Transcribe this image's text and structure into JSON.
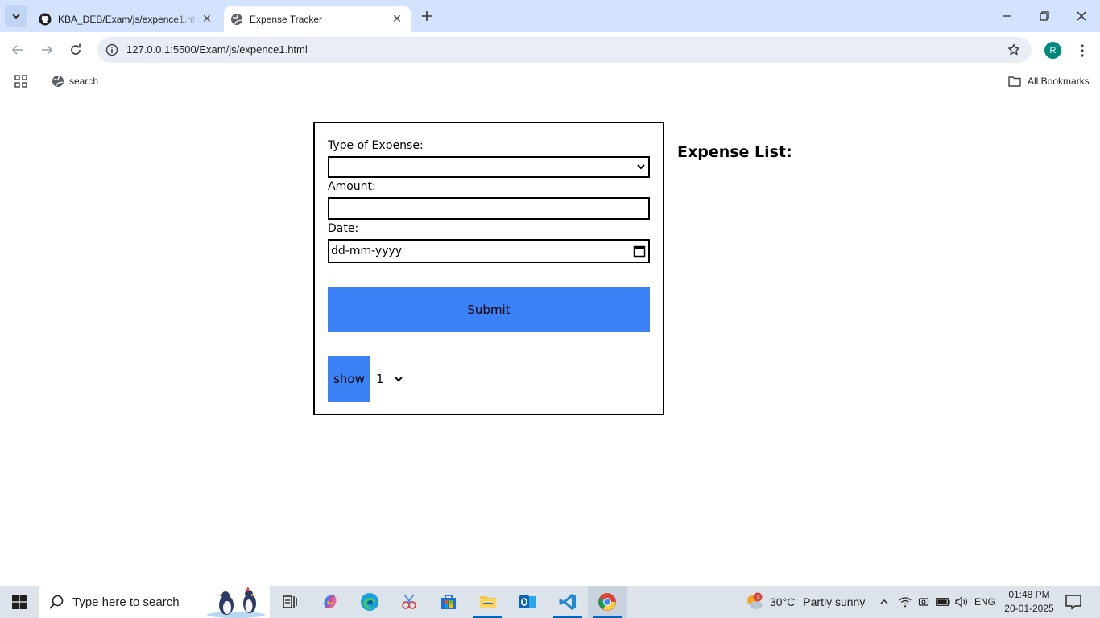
{
  "browser": {
    "tabs": [
      {
        "title": "KBA_DEB/Exam/js/expence1.html",
        "icon": "github-icon",
        "active": false
      },
      {
        "title": "Expense Tracker",
        "icon": "globe-icon",
        "active": true
      }
    ],
    "url": "127.0.0.1:5500/Exam/js/expence1.html",
    "profile_initial": "R",
    "bookmarks": [
      {
        "label": "search",
        "icon": "globe-icon"
      }
    ],
    "all_bookmarks_label": "All Bookmarks"
  },
  "page": {
    "form": {
      "type_label": "Type of Expense:",
      "type_value": "",
      "amount_label": "Amount:",
      "amount_value": "",
      "date_label": "Date:",
      "date_placeholder": "dd-mm-yyyy",
      "submit_label": "Submit",
      "show_label": "show",
      "count_value": "1"
    },
    "list_heading": "Expense List:"
  },
  "taskbar": {
    "search_placeholder": "Type here to search",
    "pinned": [
      "task-view-icon",
      "copilot-icon",
      "edge-icon",
      "snipping-tool-icon",
      "microsoft-store-icon",
      "file-explorer-icon",
      "outlook-icon",
      "vscode-icon",
      "chrome-icon"
    ],
    "weather": {
      "temp": "30°C",
      "condition": "Partly sunny",
      "badge": "1"
    },
    "language": "ENG",
    "time": "01:48 PM",
    "date": "20-01-2025"
  },
  "colors": {
    "tabstrip": "#d3e3fd",
    "button_blue": "#3b82f6",
    "taskbar": "#dde3ea"
  }
}
